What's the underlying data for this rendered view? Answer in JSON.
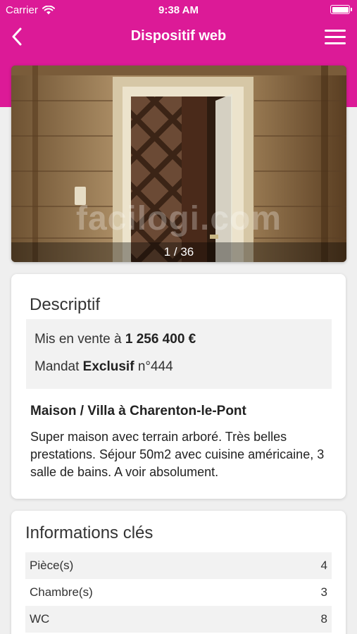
{
  "status_bar": {
    "carrier": "Carrier",
    "time": "9:38 AM"
  },
  "nav": {
    "title": "Dispositif web",
    "back_icon": "chevron-left-icon",
    "menu_icon": "hamburger-icon"
  },
  "gallery": {
    "watermark": "facilogi.com",
    "counter": "1 / 36"
  },
  "description": {
    "title": "Descriptif",
    "price_prefix": "Mis en vente à",
    "price": "1 256 400 €",
    "mandate_prefix": "Mandat",
    "mandate_type": "Exclusif",
    "mandate_number": "n°444",
    "listing_title": "Maison / Villa à Charenton-le-Pont",
    "listing_text": "Super maison avec terrain arboré. Très belles prestations. Séjour 50m2 avec cuisine américaine, 3 salle de bains. A voir absolument."
  },
  "key_info": {
    "title": "Informations clés",
    "rows": [
      {
        "label": "Pièce(s)",
        "value": "4"
      },
      {
        "label": "Chambre(s)",
        "value": "3"
      },
      {
        "label": "WC",
        "value": "8"
      }
    ]
  },
  "colors": {
    "accent": "#dc1a97",
    "background": "#efefef"
  }
}
